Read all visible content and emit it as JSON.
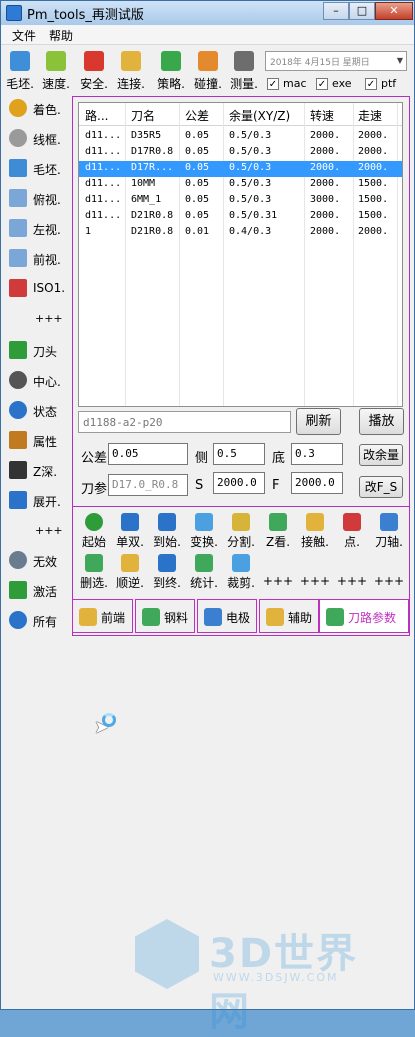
{
  "window": {
    "title": "Pm_tools_再测试版"
  },
  "menu": {
    "items": [
      "文件",
      "帮助"
    ]
  },
  "toolbar": {
    "buttons": [
      {
        "label": "毛坯.",
        "icon": "blank-icon"
      },
      {
        "label": "速度.",
        "icon": "speed-icon"
      },
      {
        "label": "安全.",
        "icon": "safety-icon"
      },
      {
        "label": "连接.",
        "icon": "link-icon"
      },
      {
        "label": "策略.",
        "icon": "strategy-icon"
      },
      {
        "label": "碰撞.",
        "icon": "collision-icon"
      },
      {
        "label": "测量.",
        "icon": "calculator-icon"
      }
    ],
    "date": "2018年  4月15日 星期日",
    "checkboxes": [
      {
        "label": "mac",
        "checked": true
      },
      {
        "label": "exe",
        "checked": true
      },
      {
        "label": "ptf",
        "checked": true
      }
    ]
  },
  "sidebar": {
    "items": [
      {
        "label": "着色.",
        "icon": "shade-icon",
        "color": "#e0a21c"
      },
      {
        "label": "线框.",
        "icon": "wireframe-icon",
        "color": "#9a9a9a"
      },
      {
        "label": "毛坯.",
        "icon": "block-icon",
        "color": "#3e8bd6"
      },
      {
        "label": "俯视.",
        "icon": "top-view-icon",
        "color": "#7aa6d8"
      },
      {
        "label": "左视.",
        "icon": "left-view-icon",
        "color": "#7aa6d8"
      },
      {
        "label": "前视.",
        "icon": "front-view-icon",
        "color": "#7aa6d8"
      },
      {
        "label": "ISO1.",
        "icon": "iso-view-icon",
        "color": "#d03a3a"
      },
      {
        "label": "刀头",
        "icon": "tool-tip-icon",
        "color": "#2f9c3a"
      },
      {
        "label": "中心.",
        "icon": "center-icon",
        "color": "#555555"
      },
      {
        "label": "状态",
        "icon": "info-icon",
        "color": "#2a73c9"
      },
      {
        "label": "属性",
        "icon": "properties-icon",
        "color": "#c07a20"
      },
      {
        "label": "Z深.",
        "icon": "z-depth-icon",
        "color": "#333333"
      },
      {
        "label": "展开.",
        "icon": "expand-icon",
        "color": "#2a73c9"
      },
      {
        "label": "无效",
        "icon": "clock-icon",
        "color": "#6a7c90"
      },
      {
        "label": "激活",
        "icon": "check-icon",
        "color": "#2f9c3a"
      },
      {
        "label": "所有",
        "icon": "all-clock-icon",
        "color": "#2a73c9"
      }
    ],
    "plus": "+++"
  },
  "list": {
    "headers": [
      "路...",
      "刀名",
      "公差",
      "余量(XY/Z)",
      "转速",
      "走速"
    ],
    "rows": [
      [
        "d11...",
        "D35R5",
        "0.05",
        "0.5/0.3",
        "2000.",
        "2000."
      ],
      [
        "d11...",
        "D17R0.8",
        "0.05",
        "0.5/0.3",
        "2000.",
        "2000."
      ],
      [
        "d11...",
        "D17R...",
        "0.05",
        "0.5/0.3",
        "2000.",
        "2000."
      ],
      [
        "d11...",
        "10MM",
        "0.05",
        "0.5/0.3",
        "2000.",
        "1500."
      ],
      [
        "d11...",
        "6MM_1",
        "0.05",
        "0.5/0.3",
        "3000.",
        "1500."
      ],
      [
        "d11...",
        "D21R0.8",
        "0.05",
        "0.5/0.31",
        "2000.",
        "1500."
      ],
      [
        "1",
        "D21R0.8",
        "0.01",
        "0.4/0.3",
        "2000.",
        "2000."
      ]
    ],
    "selected_index": 2
  },
  "form": {
    "name_value": "d1188-a2-p20",
    "refresh": "刷新",
    "play": "播放",
    "tol_label": "公差",
    "tol_value": "0.05",
    "side_label": "侧",
    "side_value": "0.5",
    "bottom_label": "底",
    "bottom_value": "0.3",
    "change_stock": "改余量",
    "tool_label": "刀参",
    "tool_value": "D17.0_R0.8",
    "s_label": "S",
    "s_value": "2000.0",
    "f_label": "F",
    "f_value": "2000.0",
    "change_fs": "改F_S"
  },
  "tools": {
    "row1": [
      {
        "label": "起始",
        "icon": "start-icon"
      },
      {
        "label": "单双.",
        "icon": "single-double-icon"
      },
      {
        "label": "到始.",
        "icon": "to-start-icon"
      },
      {
        "label": "变换.",
        "icon": "transform-icon"
      },
      {
        "label": "分割.",
        "icon": "split-icon"
      },
      {
        "label": "Z看.",
        "icon": "z-view-icon"
      },
      {
        "label": "接触.",
        "icon": "contact-icon"
      },
      {
        "label": "点.",
        "icon": "points-icon"
      },
      {
        "label": "刀轴.",
        "icon": "tool-axis-icon"
      }
    ],
    "row2": [
      {
        "label": "删选.",
        "icon": "delete-select-icon"
      },
      {
        "label": "顺逆.",
        "icon": "direction-icon"
      },
      {
        "label": "到终.",
        "icon": "to-end-icon"
      },
      {
        "label": "统计.",
        "icon": "statistics-icon"
      },
      {
        "label": "裁剪.",
        "icon": "trim-icon"
      },
      {
        "label": "+++",
        "icon": ""
      },
      {
        "label": "+++",
        "icon": ""
      },
      {
        "label": "+++",
        "icon": ""
      },
      {
        "label": "+++",
        "icon": ""
      }
    ]
  },
  "tabs": [
    {
      "label": "前端",
      "icon": "frontend-icon"
    },
    {
      "label": "钢料",
      "icon": "steel-icon"
    },
    {
      "label": "电极",
      "icon": "electrode-icon"
    },
    {
      "label": "辅助",
      "icon": "assist-icon"
    },
    {
      "label": "刀路参数",
      "icon": "toolpath-params-icon"
    }
  ],
  "watermark": {
    "title": "3D世界网",
    "url": "WWW.3DSJW.COM"
  }
}
